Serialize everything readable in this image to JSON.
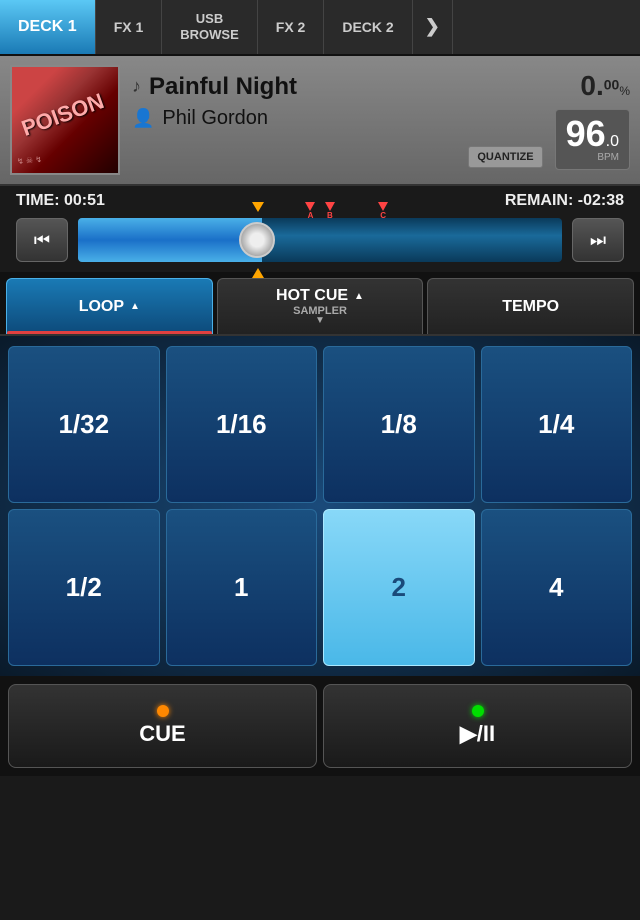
{
  "nav": {
    "deck1": "DECK 1",
    "fx1": "FX 1",
    "usb_browse": "USB\nBROWSE",
    "fx2": "FX 2",
    "deck2": "DECK 2",
    "arrow": "❯"
  },
  "track": {
    "title": "Painful Night",
    "artist": "Phil Gordon",
    "percent": "0.",
    "percent_small": "00",
    "percent_unit": "%",
    "bpm": "96",
    "bpm_decimal": ".0",
    "bpm_unit": "BPM",
    "quantize": "QUANTIZE",
    "album_label": "POISON"
  },
  "time": {
    "elapsed_label": "TIME: 00:51",
    "remain_label": "REMAIN: -02:38"
  },
  "markers": {
    "a_label": "A",
    "b_label": "B",
    "c_label": "C"
  },
  "tabs": {
    "loop": "LOOP",
    "hot_cue": "HOT CUE",
    "sampler": "SAMPLER",
    "tempo": "TEMPO"
  },
  "grid": {
    "row1": [
      "1/32",
      "1/16",
      "1/8",
      "1/4"
    ],
    "row2": [
      "1/2",
      "1",
      "2",
      "4"
    ],
    "highlighted_index": 2
  },
  "buttons": {
    "cue": "CUE",
    "play_pause": "▶/II"
  }
}
